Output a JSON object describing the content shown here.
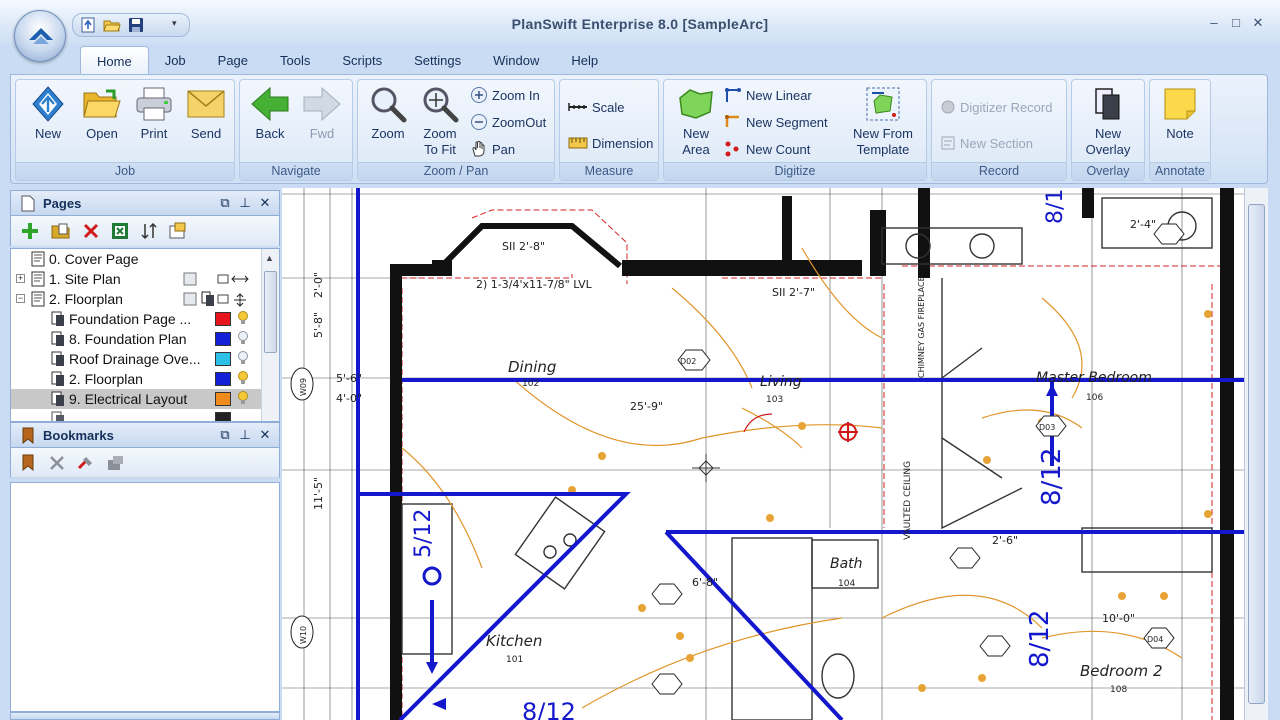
{
  "app": {
    "title": "PlanSwift Enterprise 8.0  [SampleArc]"
  },
  "tabs": [
    "Home",
    "Job",
    "Page",
    "Tools",
    "Scripts",
    "Settings",
    "Window",
    "Help"
  ],
  "ribbon": {
    "job": {
      "label": "Job",
      "new": "New",
      "open": "Open",
      "print": "Print",
      "send": "Send"
    },
    "navigate": {
      "label": "Navigate",
      "back": "Back",
      "fwd": "Fwd"
    },
    "zoom": {
      "label": "Zoom / Pan",
      "zoom": "Zoom",
      "zoom_to_fit_1": "Zoom",
      "zoom_to_fit_2": "To Fit",
      "zoom_in": "Zoom In",
      "zoom_out": "ZoomOut",
      "pan": "Pan"
    },
    "measure": {
      "label": "Measure",
      "scale": "Scale",
      "dimension": "Dimension"
    },
    "digitize": {
      "label": "Digitize",
      "new_area_1": "New",
      "new_area_2": "Area",
      "new_linear": "New Linear",
      "new_segment": "New Segment",
      "new_count": "New Count",
      "new_from_template_1": "New From",
      "new_from_template_2": "Template"
    },
    "record": {
      "label": "Record",
      "digitizer_record": "Digitizer Record",
      "new_section": "New Section"
    },
    "overlay": {
      "label": "Overlay",
      "new_overlay_1": "New",
      "new_overlay_2": "Overlay"
    },
    "annotate": {
      "label": "Annotate",
      "note": "Note"
    }
  },
  "pages_panel": {
    "title": "Pages",
    "items": [
      {
        "label": "0. Cover Page"
      },
      {
        "label": "1. Site Plan"
      },
      {
        "label": "2. Floorplan"
      },
      {
        "label": "Foundation Page ...",
        "color": "#e8141b"
      },
      {
        "label": "8. Foundation Plan",
        "color": "#1420d8"
      },
      {
        "label": "Roof Drainage Ove...",
        "color": "#2cc0e8"
      },
      {
        "label": "2. Floorplan",
        "color": "#1420d8"
      },
      {
        "label": "9. Electrical Layout",
        "color": "#f08c1e",
        "selected": true
      }
    ]
  },
  "bookmarks_panel": {
    "title": "Bookmarks"
  },
  "plan": {
    "rooms": [
      "Dining",
      "102",
      "Living",
      "103",
      "Master Bedroom",
      "106",
      "Kitchen",
      "101",
      "Bath",
      "104",
      "Bedroom 2",
      "108"
    ],
    "dims": [
      "25'-9\"",
      "5'-6\"",
      "4'-0\"",
      "11'-5\"",
      "2'-0\"",
      "5'-8\"",
      "2'-6\"",
      "6'-8\"",
      "2'-4\"",
      "10'-0\"",
      "5/12",
      "8/12",
      "SII 2'-8\"",
      "SII 2'-7\"",
      "2) 1-3/4'x11-7/8\" LVL",
      "VAULTED CEILING",
      "CHIMNEY GAS FIREPLACE",
      "D02",
      "D03",
      "D04",
      "W09",
      "W10"
    ]
  }
}
